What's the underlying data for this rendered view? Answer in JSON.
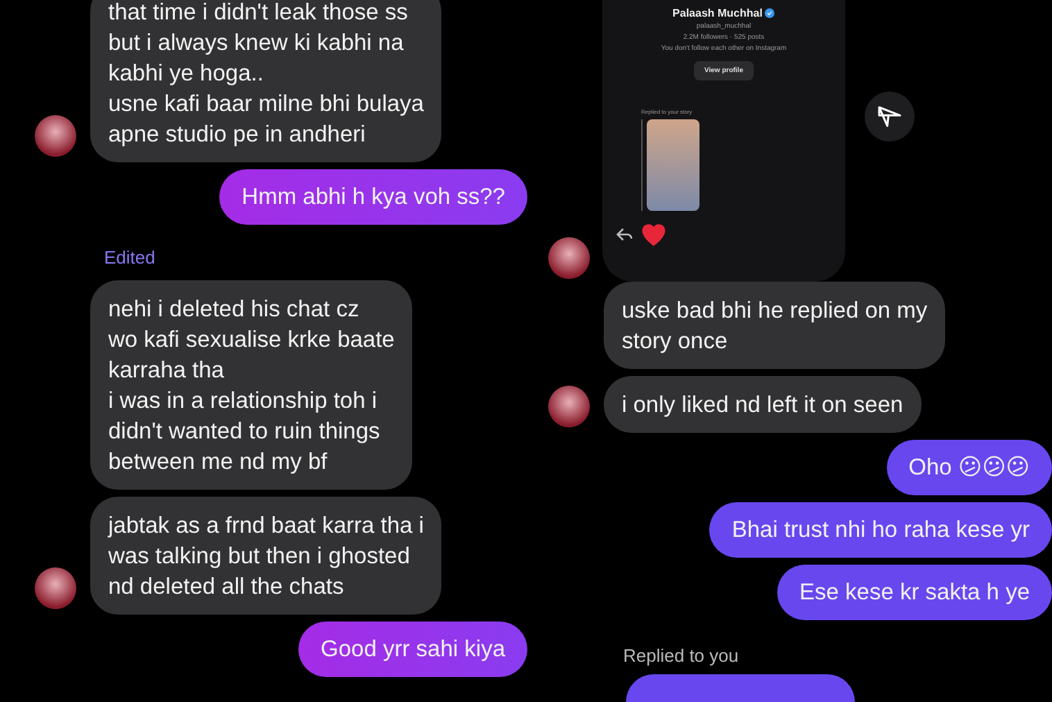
{
  "left_chat": {
    "messages": [
      {
        "kind": "incoming",
        "text": "that time i didn't leak those ss\nbut i always knew ki kabhi na\nkabhi ye hoga..\nusne kafi baar milne bhi bulaya\napne studio pe in andheri",
        "avatar": true
      },
      {
        "kind": "outgoing",
        "text": "Hmm abhi h kya voh ss??"
      },
      {
        "kind": "note",
        "text": "Edited"
      },
      {
        "kind": "incoming",
        "text": "nehi i deleted his chat cz\nwo kafi sexualise krke baate\nkarraha tha\ni was in a relationship toh i\ndidn't wanted to ruin things\nbetween me nd my bf",
        "avatar": false
      },
      {
        "kind": "incoming",
        "text": "jabtak as a frnd baat karra tha i\nwas talking but then i ghosted\nnd deleted all the chats",
        "avatar": true
      },
      {
        "kind": "outgoing",
        "text": "Good yrr sahi kiya"
      }
    ]
  },
  "right_chat": {
    "profile_card": {
      "name": "Palaash Muchhal",
      "verified": true,
      "username": "palaash_muchhal",
      "stats": "2.2M followers · 525 posts",
      "note": "You don't follow each other on Instagram",
      "button": "View profile",
      "story_label": "Replied to your story"
    },
    "messages": [
      {
        "kind": "incoming",
        "text": "uske bad bhi he replied on my\nstory once",
        "avatar": false
      },
      {
        "kind": "incoming",
        "text": "i only liked nd left it on seen",
        "avatar": true
      },
      {
        "kind": "outgoing",
        "text": "Oho 😕😕😕"
      },
      {
        "kind": "outgoing",
        "text": "Bhai trust nhi ho raha kese yr"
      },
      {
        "kind": "outgoing",
        "text": "Ese kese kr sakta h ye"
      },
      {
        "kind": "note",
        "text": "Replied to you"
      },
      {
        "kind": "outgoing",
        "partial": true
      }
    ]
  }
}
